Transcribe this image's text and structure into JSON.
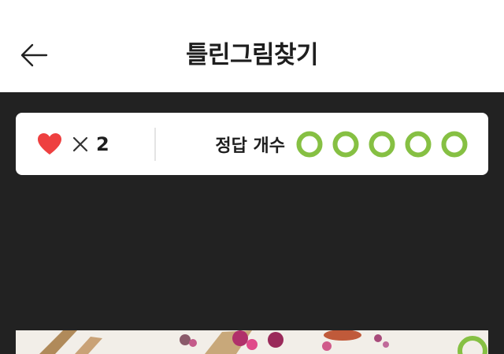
{
  "header": {
    "title": "틀린그림찾기",
    "back_icon": "arrow-left-icon"
  },
  "status": {
    "lives_icon": "heart-icon",
    "times_icon": "multiply-icon",
    "lives_count": "2",
    "answers_label": "정답 개수",
    "answer_icon": "circle-ring-icon",
    "answers_found": 0,
    "answers_total": 5
  },
  "colors": {
    "heart": "#ee4040",
    "ring": "#86c043",
    "background": "#222222",
    "card": "#ffffff"
  }
}
